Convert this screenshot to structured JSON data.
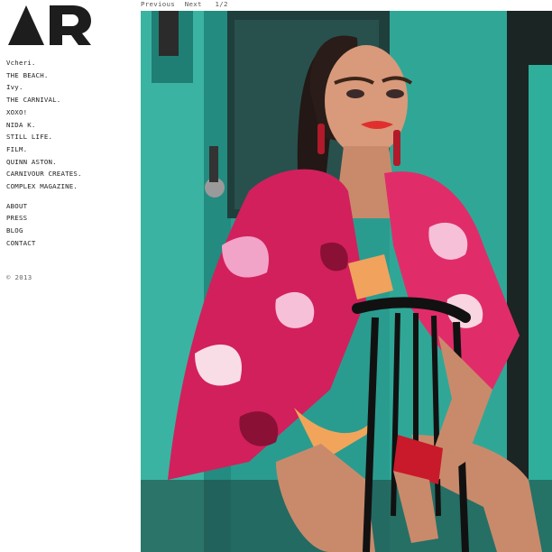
{
  "logo": {
    "text": "AR"
  },
  "nav": {
    "projects": [
      "Vcheri.",
      "THE BEACH.",
      "Ivy.",
      "THE CARNIVAL.",
      "XOXO!",
      "NIDA K.",
      "STILL LIFE.",
      "FILM.",
      "QUINN ASTON.",
      "CARNIVOUR CREATES.",
      "COMPLEX MAGAZINE."
    ],
    "pages": [
      "ABOUT",
      "PRESS",
      "BLOG",
      "CONTACT"
    ]
  },
  "footer": {
    "copyright": "© 2013"
  },
  "pager": {
    "previous": "Previous",
    "next": "Next",
    "counter": "1/2"
  },
  "photo": {
    "subject": "fashion photo: model in pink floral jacket seated on black chair before teal door"
  }
}
